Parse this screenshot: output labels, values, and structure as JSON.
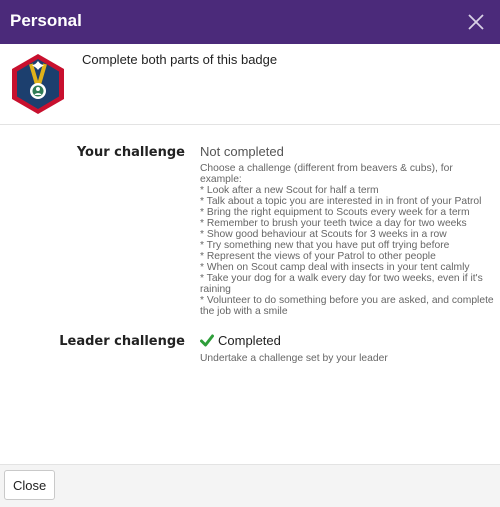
{
  "dialog": {
    "title": "Personal",
    "accent_color": "#4b2a7a",
    "close_icon": "close-icon"
  },
  "badge": {
    "icon": "personal-challenge-badge-icon",
    "intro": "Complete both parts of this badge",
    "colors": {
      "border": "#c8102e",
      "fill": "#1c3f6e",
      "ribbon": "#e0b21a"
    }
  },
  "requirements": [
    {
      "label": "Your challenge",
      "status": "Not completed",
      "completed": false,
      "description": "Choose a challenge (different from beavers & cubs), for example:\n* Look after a new Scout for half a term\n* Talk about a topic you are interested in in front of your Patrol\n* Bring the right equipment to Scouts every week for a term\n* Remember to brush your teeth twice a day for two weeks\n* Show good behaviour at Scouts for 3 weeks in a row\n* Try something new that you have put off trying before\n* Represent the views of your Patrol to other people\n* When on Scout camp deal with insects in your tent calmly\n* Take your dog for a walk every day for two weeks, even if it's raining\n* Volunteer to do something before you are asked, and complete the job with a smile"
    },
    {
      "label": "Leader challenge",
      "status": "Completed",
      "completed": true,
      "status_icon": "check-icon",
      "status_color": "#2e9e3a",
      "description": "Undertake a challenge set by your leader"
    }
  ],
  "footer": {
    "close_label": "Close"
  }
}
